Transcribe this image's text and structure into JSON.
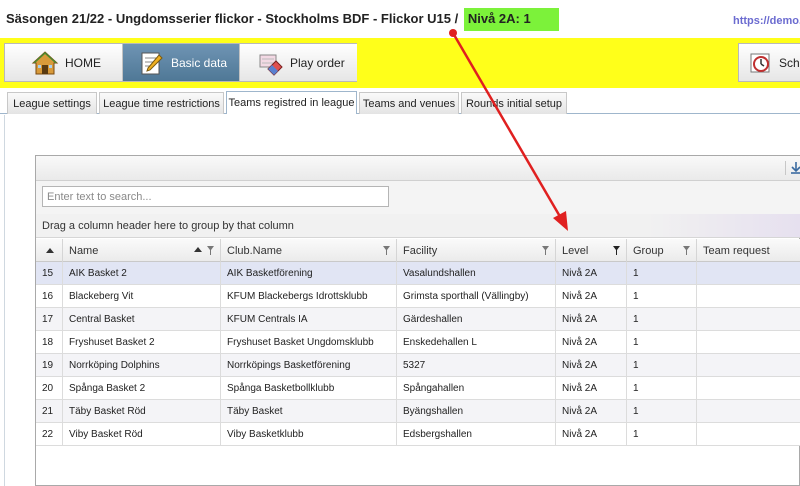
{
  "title": {
    "main": "Säsongen 21/22 - Ungdomsserier flickor - Stockholms BDF - Flickor U15 /",
    "level": "Nivå 2A: 1",
    "url": "https://demo.pro"
  },
  "toolbar": {
    "home": "HOME",
    "basic": "Basic data",
    "play": "Play order",
    "sche": "Sche"
  },
  "tabs": [
    {
      "label": "League settings"
    },
    {
      "label": "League time restrictions"
    },
    {
      "label": "Teams registred in league"
    },
    {
      "label": "Teams and venues"
    },
    {
      "label": "Rounds initial setup"
    }
  ],
  "grid": {
    "search_placeholder": "Enter text to search...",
    "group_hint": "Drag a column header here to group by that column",
    "columns": [
      "",
      "Name",
      "Club.Name",
      "Facility",
      "Level",
      "Group",
      "Team request"
    ],
    "rows": [
      {
        "id": "15",
        "name": "AIK Basket 2",
        "club": "AIK Basketförening",
        "facility": "Vasalundshallen",
        "level": "Nivå 2A",
        "group": "1"
      },
      {
        "id": "16",
        "name": "Blackeberg Vit",
        "club": "KFUM Blackebergs Idrottsklubb",
        "facility": "Grimsta sporthall (Vällingby)",
        "level": "Nivå 2A",
        "group": "1"
      },
      {
        "id": "17",
        "name": "Central Basket",
        "club": "KFUM Centrals IA",
        "facility": "Gärdeshallen",
        "level": "Nivå 2A",
        "group": "1"
      },
      {
        "id": "18",
        "name": "Fryshuset Basket 2",
        "club": "Fryshuset Basket Ungdomsklubb",
        "facility": "Enskedehallen L",
        "level": "Nivå 2A",
        "group": "1"
      },
      {
        "id": "19",
        "name": "Norrköping Dolphins",
        "club": "Norrköpings Basketförening",
        "facility": "5327",
        "level": "Nivå 2A",
        "group": "1"
      },
      {
        "id": "20",
        "name": "Spånga Basket 2",
        "club": "Spånga Basketbollklubb",
        "facility": "Spångahallen",
        "level": "Nivå 2A",
        "group": "1"
      },
      {
        "id": "21",
        "name": "Täby Basket Röd",
        "club": "Täby Basket",
        "facility": "Byängshallen",
        "level": "Nivå 2A",
        "group": "1"
      },
      {
        "id": "22",
        "name": "Viby Basket Röd",
        "club": "Viby Basketklubb",
        "facility": "Edsbergshallen",
        "level": "Nivå 2A",
        "group": "1"
      }
    ]
  },
  "colors": {
    "toolbar": "#ffff1a",
    "level_highlight": "#7cf23a",
    "active_button": "#5a83a3",
    "annotation_arrow": "#e02020",
    "url": "#6b6bd0"
  },
  "icons": [
    "home-icon",
    "edit-document-icon",
    "eraser-icon",
    "clock-icon",
    "export-icon",
    "filter-icon",
    "sort-ascending-icon"
  ]
}
